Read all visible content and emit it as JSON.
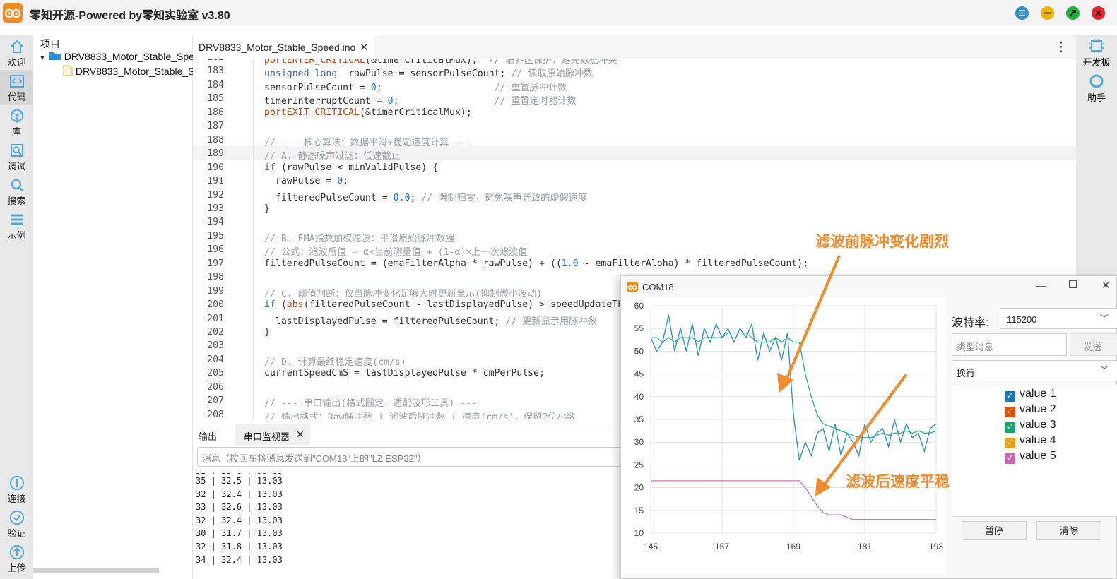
{
  "window": {
    "title": "零知开源-Powered by零知实验室 v3.80"
  },
  "leftbar": [
    {
      "label": "欢迎",
      "icon": "home-icon"
    },
    {
      "label": "代码",
      "icon": "code-icon"
    },
    {
      "label": "库",
      "icon": "library-icon"
    },
    {
      "label": "调试",
      "icon": "debug-icon"
    },
    {
      "label": "搜索",
      "icon": "search-icon"
    },
    {
      "label": "示例",
      "icon": "examples-icon"
    }
  ],
  "leftbar_bottom": [
    {
      "label": "连接",
      "icon": "connect-icon"
    },
    {
      "label": "验证",
      "icon": "verify-icon"
    },
    {
      "label": "上传",
      "icon": "upload-icon"
    }
  ],
  "rightbar": [
    {
      "label": "开发板",
      "icon": "board-icon"
    },
    {
      "label": "助手",
      "icon": "assistant-icon"
    }
  ],
  "tree": {
    "header": "项目",
    "project": "DRV8833_Motor_Stable_Spe",
    "file": "DRV8833_Motor_Stable_S"
  },
  "editor": {
    "tab": "DRV8833_Motor_Stable_Speed.ino",
    "menu": "⋮"
  },
  "bottom": {
    "tabs": [
      "输出",
      "串口监视器"
    ],
    "input_placeholder": "消息（按回车将消息发送到\"COM18\"上的\"LZ ESP32\"）",
    "lines": [
      "35 | 32.5 | 13.03",
      "32 | 32.4 | 13.03",
      "33 | 32.6 | 13.03",
      "32 | 32.4 | 13.03",
      "30 | 31.7 | 13.03",
      "32 | 31.8 | 13.03",
      "34 | 32.4 | 13.03"
    ]
  },
  "com": {
    "title": "COM18",
    "baud_label": "波特率:",
    "baud_value": "115200",
    "message_placeholder": "类型消息",
    "send": "发送",
    "line_ending": "换行",
    "legend": [
      {
        "name": "value 1",
        "color": "#1e73b8"
      },
      {
        "name": "value 2",
        "color": "#d9530f"
      },
      {
        "name": "value 3",
        "color": "#1aa56e"
      },
      {
        "name": "value 4",
        "color": "#e6a118"
      },
      {
        "name": "value 5",
        "color": "#c867b0"
      }
    ],
    "pause": "暂停",
    "clear": "清除"
  },
  "annotations": {
    "before": "滤波前脉冲变化剧烈",
    "after": "滤波后速度平稳"
  },
  "chart_data": {
    "type": "line",
    "x": [
      145,
      146,
      147,
      148,
      149,
      150,
      151,
      152,
      153,
      154,
      155,
      156,
      157,
      158,
      159,
      160,
      161,
      162,
      163,
      164,
      165,
      166,
      167,
      168,
      169,
      170,
      171,
      172,
      173,
      174,
      175,
      176,
      177,
      178,
      179,
      180,
      181,
      182,
      183,
      184,
      185,
      186,
      187,
      188,
      189,
      190,
      191,
      192,
      193
    ],
    "xticks": [
      145,
      157,
      169,
      181,
      193
    ],
    "ylim": [
      10,
      60
    ],
    "yticks": [
      10,
      15,
      20,
      25,
      30,
      35,
      40,
      45,
      50,
      55,
      60
    ],
    "series": [
      {
        "name": "value 1",
        "color": "#2a8ac6",
        "values": [
          53,
          50,
          52,
          58,
          50,
          55,
          50,
          56,
          49,
          55,
          52,
          56,
          53,
          55,
          52,
          55,
          53,
          56,
          48,
          54,
          50,
          53,
          48,
          54,
          36,
          26,
          30,
          27,
          32,
          33,
          28,
          34,
          27,
          32,
          30,
          27,
          34,
          30,
          32,
          33,
          29,
          35,
          30,
          34,
          31,
          32,
          28,
          33,
          34
        ]
      },
      {
        "name": "value 3",
        "color": "#2bb08a",
        "values": [
          53,
          53,
          52,
          53,
          52,
          53,
          53,
          53,
          52,
          53,
          53,
          53,
          53,
          54,
          54,
          54,
          54,
          53,
          52,
          52,
          52,
          53,
          52,
          53,
          52,
          52,
          45,
          40,
          36,
          34,
          33.5,
          33,
          32.5,
          32,
          31.5,
          31,
          31,
          31,
          31.5,
          32,
          31.5,
          32,
          32,
          32.5,
          32,
          32.5,
          32,
          32,
          32.5
        ]
      },
      {
        "name": "value 5",
        "color": "#cc77be",
        "values": [
          21.5,
          21.5,
          21.5,
          21.5,
          21.5,
          21.5,
          21.5,
          21.5,
          21.5,
          21.5,
          21.5,
          21.5,
          21.5,
          21.5,
          21.5,
          21.5,
          21.5,
          21.5,
          21.5,
          21.5,
          21.5,
          21.5,
          21.5,
          21.5,
          21.5,
          21.5,
          20,
          18,
          16,
          14.5,
          14,
          14,
          14,
          13.5,
          13,
          13,
          13,
          13,
          13,
          13,
          13,
          13,
          13,
          13,
          13,
          13,
          13,
          13,
          13
        ]
      }
    ],
    "grid": true
  },
  "code": {
    "start_line": 182,
    "lines": [
      [
        [
          "fn",
          "portENTER_CRITICAL"
        ],
        [
          "",
          "(&timerCriticalMux);  "
        ],
        [
          "cm",
          "// 临界区保护，避免数据冲突"
        ]
      ],
      [
        [
          "kw",
          "unsigned long"
        ],
        [
          "",
          "  rawPulse = sensorPulseCount; "
        ],
        [
          "cm",
          "// 读取原始脉冲数"
        ]
      ],
      [
        [
          "",
          "sensorPulseCount = "
        ],
        [
          "nm",
          "0"
        ],
        [
          "",
          ";                    "
        ],
        [
          "cm",
          "// 重置脉冲计数"
        ]
      ],
      [
        [
          "",
          "timerInterruptCount = "
        ],
        [
          "nm",
          "0"
        ],
        [
          "",
          ";                 "
        ],
        [
          "cm",
          "// 重置定时器计数"
        ]
      ],
      [
        [
          "fn",
          "portEXIT_CRITICAL"
        ],
        [
          "",
          "(&timerCriticalMux);"
        ]
      ],
      [],
      [
        [
          "cm",
          "// --- 核心算法：数据平滑+稳定速度计算 ---"
        ]
      ],
      [
        [
          "cm",
          "// A. 静态噪声过滤：低速截止"
        ]
      ],
      [
        [
          "kw",
          "if"
        ],
        [
          "",
          " (rawPulse < minValidPulse) {"
        ]
      ],
      [
        [
          "",
          "  rawPulse = "
        ],
        [
          "nm",
          "0"
        ],
        [
          "",
          ";"
        ]
      ],
      [
        [
          "",
          "  filteredPulseCount = "
        ],
        [
          "nm",
          "0.0"
        ],
        [
          "",
          "; "
        ],
        [
          "cm",
          "// 强制归零，避免噪声导致的虚假速度"
        ]
      ],
      [
        [
          "",
          "}"
        ]
      ],
      [],
      [
        [
          "cm",
          "// B. EMA指数加权滤波：平滑原始脉冲数据"
        ]
      ],
      [
        [
          "cm",
          "// 公式：滤波后值 = α×当前测量值 + (1-α)×上一次滤波值"
        ]
      ],
      [
        [
          "",
          "filteredPulseCount = (emaFilterAlpha * rawPulse) + (("
        ],
        [
          "nm",
          "1.0"
        ],
        [
          "",
          " - emaFilterAlpha) * filteredPulseCount);"
        ]
      ],
      [],
      [
        [
          "cm",
          "// C. 阈值判断：仅当脉冲变化足够大时更新显示(抑制微小波动)"
        ]
      ],
      [
        [
          "kw",
          "if"
        ],
        [
          "",
          " ("
        ],
        [
          "fn",
          "abs"
        ],
        [
          "",
          "(filteredPulseCount - lastDisplayedPulse) > speedUpdateThreshold) {"
        ]
      ],
      [
        [
          "",
          "  lastDisplayedPulse = filteredPulseCount; "
        ],
        [
          "cm",
          "// 更新显示用脉冲数"
        ]
      ],
      [
        [
          "",
          "}"
        ]
      ],
      [],
      [
        [
          "cm",
          "// D. 计算最终稳定速度(cm/s)"
        ]
      ],
      [
        [
          "",
          "currentSpeedCmS = lastDisplayedPulse * cmPerPulse;"
        ]
      ],
      [],
      [
        [
          "cm",
          "// --- 串口输出(格式固定，适配波形工具) ---"
        ]
      ],
      [
        [
          "cm",
          "// 输出格式：Raw脉冲数 | 滤波后脉冲数 | 速度(cm/s)，保留2位小数"
        ]
      ]
    ]
  }
}
